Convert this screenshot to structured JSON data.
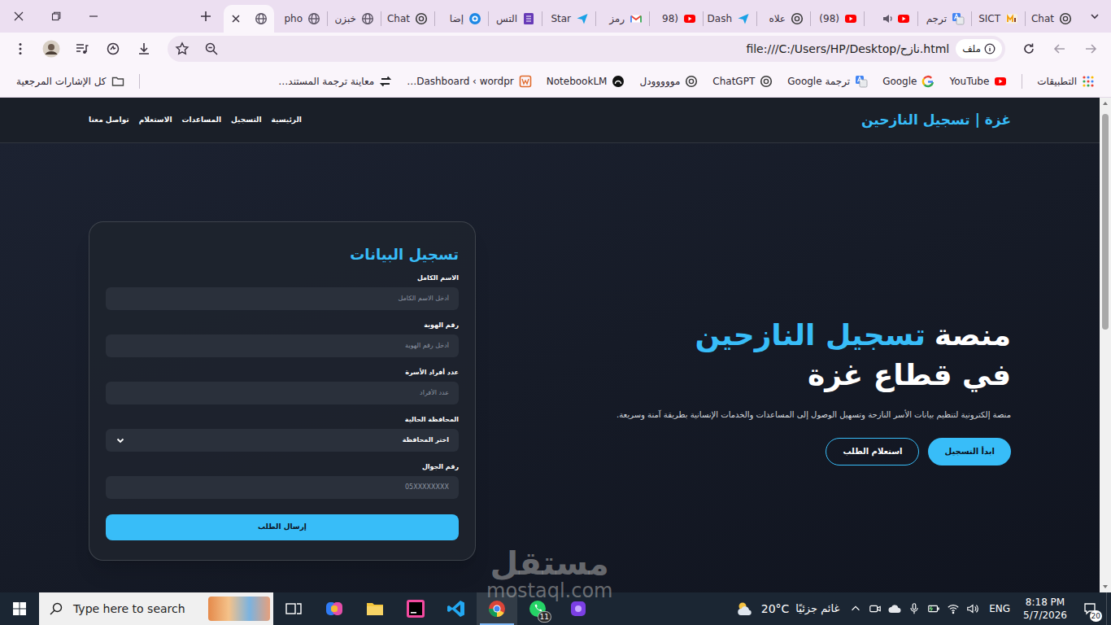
{
  "browser": {
    "tabs": [
      {
        "label": "Chat",
        "kind": "chatgpt",
        "selected": false
      },
      {
        "label": "SICT",
        "kind": "m",
        "selected": false
      },
      {
        "label": "ترجم",
        "kind": "translate",
        "selected": false
      },
      {
        "kind": "audio-youtube",
        "selected": false
      },
      {
        "label": "(98)",
        "kind": "youtube",
        "selected": false
      },
      {
        "label": "علاه",
        "kind": "chatgpt",
        "selected": false
      },
      {
        "label": "Dash",
        "kind": "arrow",
        "selected": false
      },
      {
        "label": "(98",
        "kind": "youtube",
        "selected": false
      },
      {
        "label": "رمز",
        "kind": "gmail",
        "selected": false
      },
      {
        "label": "Star",
        "kind": "arrow",
        "selected": false
      },
      {
        "label": "التس",
        "kind": "form",
        "selected": false
      },
      {
        "label": "إضا",
        "kind": "target",
        "selected": false
      },
      {
        "label": "Chat",
        "kind": "chatgpt",
        "selected": false
      },
      {
        "label": "خبزن",
        "kind": "globe",
        "selected": false
      },
      {
        "label": "pho",
        "kind": "globe",
        "selected": false
      },
      {
        "kind": "globe",
        "selected": true
      }
    ],
    "navigation": {
      "back_disabled": true,
      "forward_disabled": true
    },
    "omnibox": {
      "chip": "ملف",
      "url": "file:///C:/Users/HP/Desktop/نازح.html"
    },
    "bookmarks": [
      {
        "label": "التطبيقات",
        "kind": "apps"
      },
      {
        "label": "YouTube",
        "kind": "youtube"
      },
      {
        "label": "Google",
        "kind": "google"
      },
      {
        "label": "ترجمة Google",
        "kind": "translate"
      },
      {
        "label": "ChatGPT",
        "kind": "chatgpt"
      },
      {
        "label": "مووووودل",
        "kind": "chatgpt"
      },
      {
        "label": "NotebookLM",
        "kind": "notebook"
      },
      {
        "label": "Dashboard ‹ wordpr…",
        "kind": "wordpress"
      },
      {
        "label": "معاينة ترجمة المستند…",
        "kind": "doc"
      }
    ],
    "all_bookmarks": "كل الإشارات المرجعية"
  },
  "page": {
    "logo": "غزة | تسجيل النازحين",
    "nav": [
      "الرئيسية",
      "التسجيل",
      "المساعدات",
      "الاستعلام",
      "تواصل معنا"
    ],
    "hero": {
      "title_start": "منصة",
      "title_highlight": "تسجيل النازحين",
      "title_line2": "في قطاع غزة",
      "description": "منصة إلكترونية لتنظيم بيانات الأسر النازحة وتسهيل الوصول إلى المساعدات والخدمات الإنسانية بطريقة آمنة وسريعة.",
      "buttons": [
        {
          "label": "ابدأ التسجيل",
          "kind": "primary"
        },
        {
          "label": "استعلام الطلب",
          "kind": "outline"
        }
      ]
    },
    "form": {
      "title": "تسجيل البيانات",
      "fields": [
        {
          "label": "الاسم الكامل",
          "kind": "input",
          "placeholder": "أدخل الاسم الكامل"
        },
        {
          "label": "رقم الهوية",
          "kind": "input",
          "placeholder": "أدخل رقم الهوية"
        },
        {
          "label": "عدد أفراد الأسرة",
          "kind": "input",
          "placeholder": "عدد الأفراد"
        },
        {
          "label": "المحافظة الحالية",
          "kind": "select",
          "value": "اختر المحافظة"
        },
        {
          "label": "رقم الجوال",
          "kind": "input",
          "placeholder": "05XXXXXXXX"
        }
      ],
      "submit": "إرسال الطلب"
    }
  },
  "taskbar": {
    "search_placeholder": "Type here to search",
    "apps": [
      {
        "kind": "taskview",
        "selected": false
      },
      {
        "kind": "copilot",
        "selected": false
      },
      {
        "kind": "explorer",
        "selected": false
      },
      {
        "kind": "intellij",
        "selected": false
      },
      {
        "kind": "vscode",
        "selected": false
      },
      {
        "kind": "chrome",
        "selected": true
      },
      {
        "kind": "whatsapp",
        "selected": false,
        "badge": "11"
      },
      {
        "kind": "app",
        "selected": false
      }
    ],
    "weather": {
      "temperature": "20°C",
      "condition": "غائم جزئيًا"
    },
    "language": "ENG",
    "time": "8:18 PM",
    "date": "5/7/2026",
    "notifications": "20"
  },
  "watermark": {
    "title": "مستقل",
    "site": "mostaql.com"
  }
}
